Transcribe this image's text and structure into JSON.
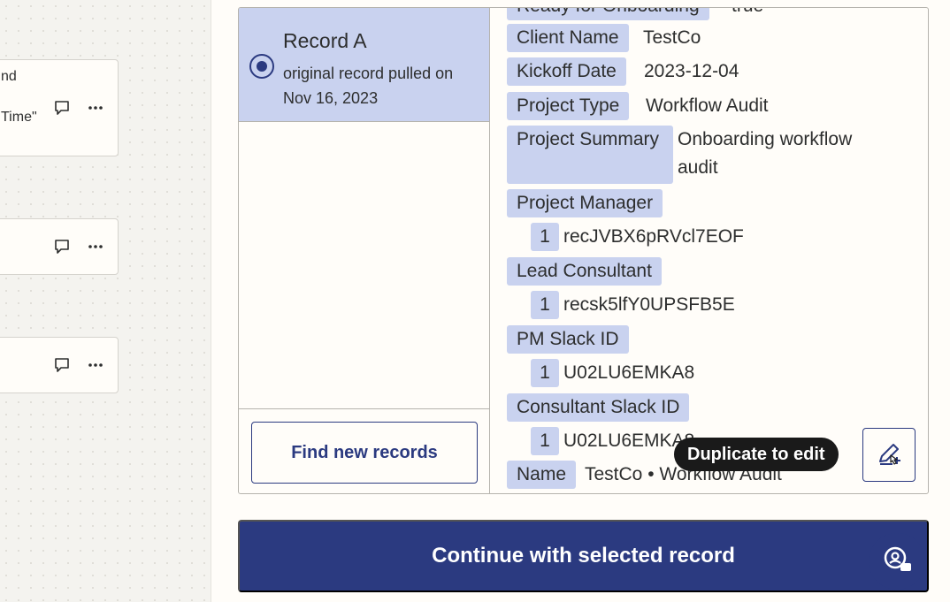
{
  "canvas": {
    "cards": [
      {
        "fragments": [
          "nd",
          "Time\""
        ]
      },
      {
        "fragments": []
      },
      {
        "fragments": []
      }
    ]
  },
  "records_list": {
    "items": [
      {
        "title": "Record A",
        "subtitle": "original record pulled on Nov 16, 2023",
        "selected": true
      }
    ],
    "find_button_label": "Find new records"
  },
  "record_detail": {
    "cut_off_label": "Ready for Onboarding",
    "cut_off_value": "true",
    "fields": [
      {
        "label": "Client Name",
        "value": "TestCo"
      },
      {
        "label": "Kickoff Date",
        "value": "2023-12-04"
      },
      {
        "label": "Project Type",
        "value": "Workflow Audit"
      },
      {
        "label": "Project Summary",
        "value": "Onboarding workflow audit"
      },
      {
        "label": "Project Manager",
        "index": "1",
        "value": "recJVBX6pRVcl7EOF"
      },
      {
        "label": "Lead Consultant",
        "index": "1",
        "value": "recsk5lfY0UPSFB5E"
      },
      {
        "label": "PM Slack ID",
        "index": "1",
        "value": "U02LU6EMKA8"
      },
      {
        "label": "Consultant Slack ID",
        "index": "1",
        "value": "U02LU6EMKA8"
      },
      {
        "label": "Name",
        "value": "TestCo • Workflow Audit"
      }
    ]
  },
  "tooltip": "Duplicate to edit",
  "continue_button_label": "Continue with selected record",
  "colors": {
    "accent": "#2b3a80",
    "selected_bg": "#c9d2ef",
    "panel_bg": "#fffdf9"
  },
  "icons": {
    "comment": "comment-icon",
    "more": "more-icon",
    "duplicate": "duplicate-edit-icon",
    "help": "help-chat-icon",
    "radio": "radio-selected-icon"
  }
}
